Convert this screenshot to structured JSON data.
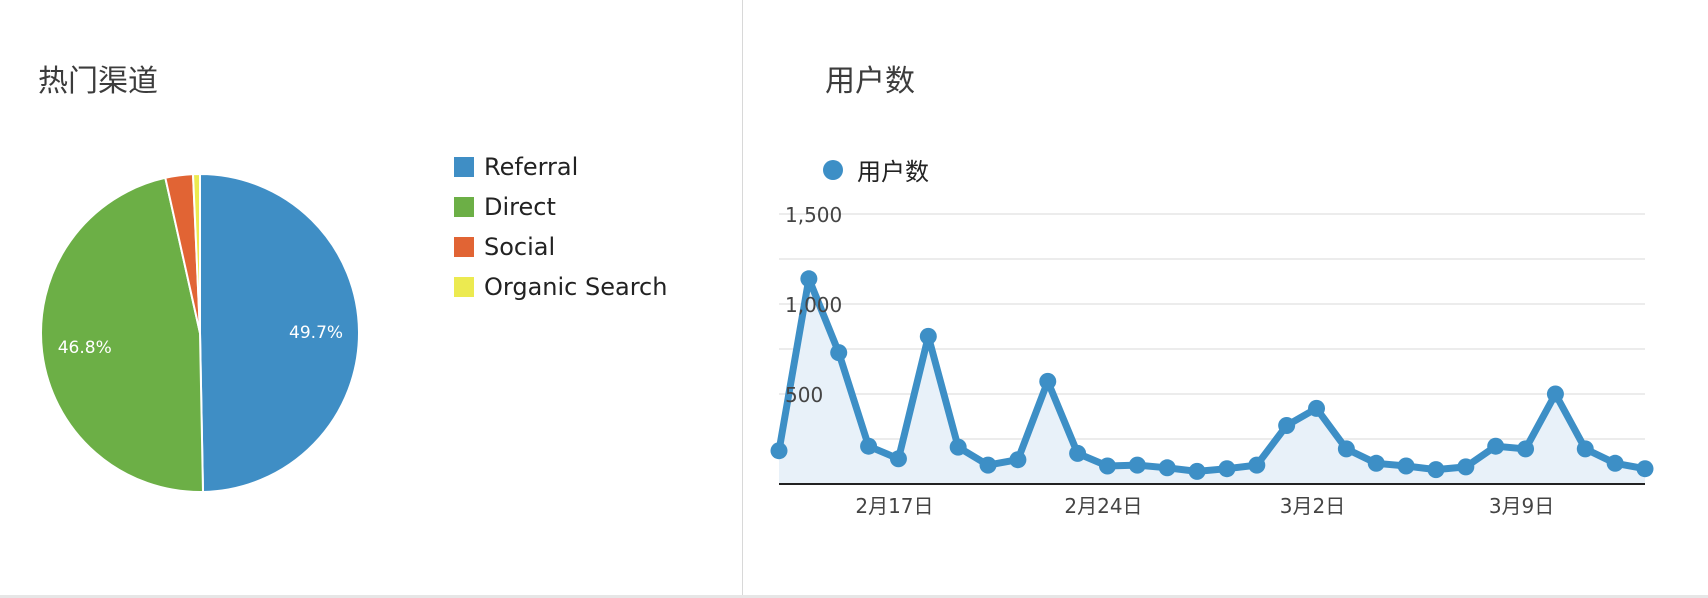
{
  "pie_card": {
    "title": "热门渠道"
  },
  "line_card": {
    "title": "用户数"
  },
  "colors": {
    "referral": "#3f8ec5",
    "direct": "#6caf46",
    "social": "#e16434",
    "organic": "#ecea50",
    "line": "#3d8fc6",
    "area": "#e8f1f9",
    "grid": "#e6e6e6",
    "axis": "#222222"
  },
  "chart_data": [
    {
      "type": "pie",
      "title": "热门渠道",
      "legend_position": "right",
      "slices": [
        {
          "name": "Referral",
          "value": 49.7,
          "label": "49.7%",
          "color": "#3f8ec5"
        },
        {
          "name": "Direct",
          "value": 46.8,
          "label": "46.8%",
          "color": "#6caf46"
        },
        {
          "name": "Social",
          "value": 2.8,
          "label": "",
          "color": "#e16434"
        },
        {
          "name": "Organic Search",
          "value": 0.7,
          "label": "",
          "color": "#ecea50"
        }
      ]
    },
    {
      "type": "area",
      "title": "用户数",
      "legend_position": "top-left",
      "grid": true,
      "ylim": [
        0,
        1500
      ],
      "yticks": [
        "1,500",
        "1,000",
        "500"
      ],
      "ytick_values": [
        1500,
        1000,
        500
      ],
      "xtick_labels": [
        "2月17日",
        "2月24日",
        "3月2日",
        "3月9日"
      ],
      "xtick_indices": [
        4,
        11,
        18,
        25
      ],
      "series": [
        {
          "name": "用户数",
          "color": "#3d8fc6",
          "values": [
            185,
            1140,
            730,
            210,
            140,
            820,
            205,
            105,
            135,
            570,
            170,
            100,
            105,
            90,
            70,
            85,
            105,
            325,
            420,
            195,
            115,
            100,
            80,
            95,
            210,
            195,
            500,
            195,
            115,
            85
          ]
        }
      ]
    }
  ]
}
